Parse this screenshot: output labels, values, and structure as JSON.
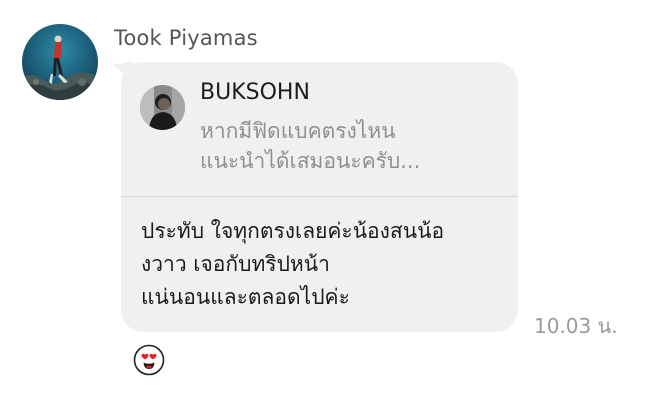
{
  "sender": {
    "name": "Took Piyamas",
    "avatar_icon": "diver-photo-avatar"
  },
  "message": {
    "reply_to": {
      "author": "BUKSOHN",
      "avatar_icon": "profile-photo-avatar",
      "preview_line1": "หากมีฟิดแบคตรงไหน",
      "preview_line2": "แนะนำได้เสมอนะครับ..."
    },
    "text_line1": "ประทับ ใจทุกตรงเลยค่ะน้องสนน้อ",
    "text_line2": "งวาว เจอกับทริปหน้า",
    "text_line3": "แน่นอนและตลอดไปค่ะ",
    "timestamp": "10.03 น.",
    "reaction_icon": "heart-eyes-emoji-icon"
  },
  "colors": {
    "bubble": "#f0f0f0",
    "divider": "#d3d3d3",
    "quote_text": "#8f8f8f",
    "timestamp": "#9a9a9a"
  }
}
